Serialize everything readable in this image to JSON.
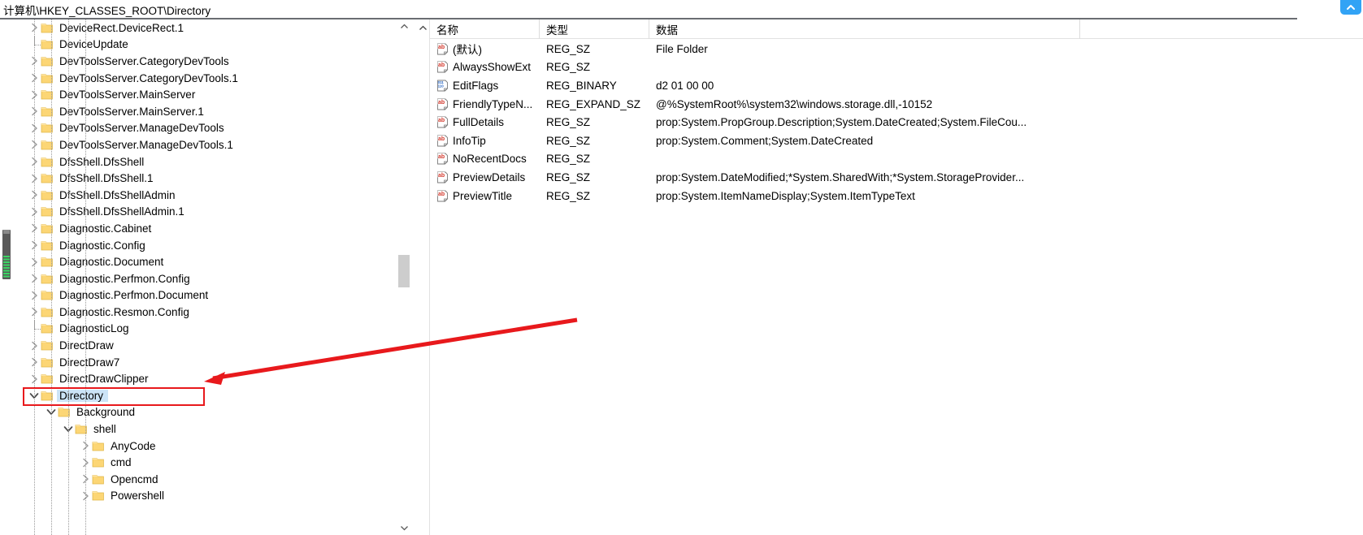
{
  "address": {
    "path": "计算机\\HKEY_CLASSES_ROOT\\Directory"
  },
  "icons": {
    "folder": "folder-icon",
    "chevron_right": "chevron-right-icon",
    "chevron_down": "chevron-down-icon",
    "string_value": "ab-string-value-icon",
    "binary_value": "binary-value-icon",
    "scroll_up": "scroll-up-arrow-icon",
    "scroll_down": "scroll-down-arrow-icon",
    "badge": "blue-chevron-badge-icon"
  },
  "colors": {
    "selection": "#cce4f7",
    "annotation_red": "#e8191c",
    "folder_yellow": "#fcd675",
    "badge_blue": "#32a3f5",
    "scroll_green": "#3ad664"
  },
  "tree": {
    "items": [
      {
        "label": "DeviceRect.DeviceRect.1",
        "depth": 1,
        "state": "collapsed",
        "selected": false
      },
      {
        "label": "DeviceUpdate",
        "depth": 1,
        "state": "leaf",
        "selected": false
      },
      {
        "label": "DevToolsServer.CategoryDevTools",
        "depth": 1,
        "state": "collapsed",
        "selected": false
      },
      {
        "label": "DevToolsServer.CategoryDevTools.1",
        "depth": 1,
        "state": "collapsed",
        "selected": false
      },
      {
        "label": "DevToolsServer.MainServer",
        "depth": 1,
        "state": "collapsed",
        "selected": false
      },
      {
        "label": "DevToolsServer.MainServer.1",
        "depth": 1,
        "state": "collapsed",
        "selected": false
      },
      {
        "label": "DevToolsServer.ManageDevTools",
        "depth": 1,
        "state": "collapsed",
        "selected": false
      },
      {
        "label": "DevToolsServer.ManageDevTools.1",
        "depth": 1,
        "state": "collapsed",
        "selected": false
      },
      {
        "label": "DfsShell.DfsShell",
        "depth": 1,
        "state": "collapsed",
        "selected": false
      },
      {
        "label": "DfsShell.DfsShell.1",
        "depth": 1,
        "state": "collapsed",
        "selected": false
      },
      {
        "label": "DfsShell.DfsShellAdmin",
        "depth": 1,
        "state": "collapsed",
        "selected": false
      },
      {
        "label": "DfsShell.DfsShellAdmin.1",
        "depth": 1,
        "state": "collapsed",
        "selected": false
      },
      {
        "label": "Diagnostic.Cabinet",
        "depth": 1,
        "state": "collapsed",
        "selected": false
      },
      {
        "label": "Diagnostic.Config",
        "depth": 1,
        "state": "collapsed",
        "selected": false
      },
      {
        "label": "Diagnostic.Document",
        "depth": 1,
        "state": "collapsed",
        "selected": false
      },
      {
        "label": "Diagnostic.Perfmon.Config",
        "depth": 1,
        "state": "collapsed",
        "selected": false
      },
      {
        "label": "Diagnostic.Perfmon.Document",
        "depth": 1,
        "state": "collapsed",
        "selected": false
      },
      {
        "label": "Diagnostic.Resmon.Config",
        "depth": 1,
        "state": "collapsed",
        "selected": false
      },
      {
        "label": "DiagnosticLog",
        "depth": 1,
        "state": "leaf",
        "selected": false
      },
      {
        "label": "DirectDraw",
        "depth": 1,
        "state": "collapsed",
        "selected": false
      },
      {
        "label": "DirectDraw7",
        "depth": 1,
        "state": "collapsed",
        "selected": false
      },
      {
        "label": "DirectDrawClipper",
        "depth": 1,
        "state": "collapsed",
        "selected": false
      },
      {
        "label": "Directory",
        "depth": 1,
        "state": "expanded",
        "selected": true
      },
      {
        "label": "Background",
        "depth": 2,
        "state": "expanded",
        "selected": false
      },
      {
        "label": "shell",
        "depth": 3,
        "state": "expanded",
        "selected": false
      },
      {
        "label": "AnyCode",
        "depth": 4,
        "state": "collapsed",
        "selected": false
      },
      {
        "label": "cmd",
        "depth": 4,
        "state": "collapsed",
        "selected": false
      },
      {
        "label": "Opencmd",
        "depth": 4,
        "state": "collapsed",
        "selected": false
      },
      {
        "label": "Powershell",
        "depth": 4,
        "state": "collapsed",
        "selected": false
      }
    ]
  },
  "list": {
    "columns": [
      "名称",
      "类型",
      "数据"
    ],
    "rows": [
      {
        "name": "(默认)",
        "type": "REG_SZ",
        "data": "File Folder",
        "icon": "string"
      },
      {
        "name": "AlwaysShowExt",
        "type": "REG_SZ",
        "data": "",
        "icon": "string"
      },
      {
        "name": "EditFlags",
        "type": "REG_BINARY",
        "data": "d2 01 00 00",
        "icon": "binary"
      },
      {
        "name": "FriendlyTypeN...",
        "type": "REG_EXPAND_SZ",
        "data": "@%SystemRoot%\\system32\\windows.storage.dll,-10152",
        "icon": "string"
      },
      {
        "name": "FullDetails",
        "type": "REG_SZ",
        "data": "prop:System.PropGroup.Description;System.DateCreated;System.FileCou...",
        "icon": "string"
      },
      {
        "name": "InfoTip",
        "type": "REG_SZ",
        "data": "prop:System.Comment;System.DateCreated",
        "icon": "string"
      },
      {
        "name": "NoRecentDocs",
        "type": "REG_SZ",
        "data": "",
        "icon": "string"
      },
      {
        "name": "PreviewDetails",
        "type": "REG_SZ",
        "data": "prop:System.DateModified;*System.SharedWith;*System.StorageProvider...",
        "icon": "string"
      },
      {
        "name": "PreviewTitle",
        "type": "REG_SZ",
        "data": "prop:System.ItemNameDisplay;System.ItemTypeText",
        "icon": "string"
      }
    ]
  }
}
